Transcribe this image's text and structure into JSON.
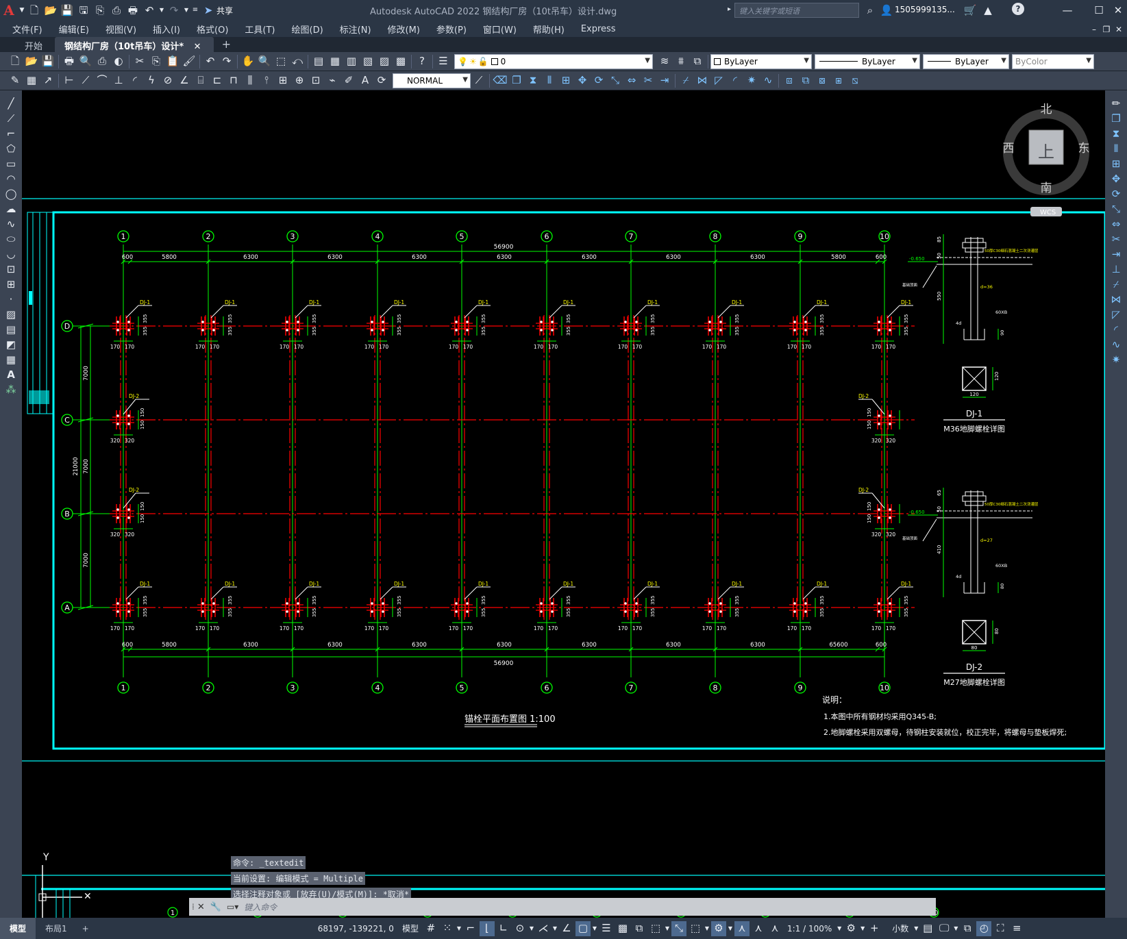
{
  "app": {
    "logo": "A",
    "title": "Autodesk AutoCAD 2022    钢结构厂房（10t吊车）设计.dwg",
    "share_label": "共享",
    "search_placeholder": "键入关键字或短语",
    "user": "1505999135...",
    "window_controls": [
      "—",
      "☐",
      "✕"
    ]
  },
  "menu": [
    "文件(F)",
    "编辑(E)",
    "视图(V)",
    "插入(I)",
    "格式(O)",
    "工具(T)",
    "绘图(D)",
    "标注(N)",
    "修改(M)",
    "参数(P)",
    "窗口(W)",
    "帮助(H)",
    "Express"
  ],
  "tabs": {
    "start": "开始",
    "doc": "钢结构厂房（10t吊车）设计*",
    "close": "✕",
    "add": "+"
  },
  "toolbar": {
    "layer": "0",
    "color": "ByLayer",
    "linetype": "ByLayer",
    "lineweight": "ByLayer",
    "plotstyle": "ByColor",
    "dimstyle": "NORMAL"
  },
  "viewcube": {
    "north": "北",
    "south": "南",
    "east": "东",
    "west": "西",
    "top": "上",
    "wcs": "WCS"
  },
  "drawing": {
    "axes_x": [
      "1",
      "2",
      "3",
      "4",
      "5",
      "6",
      "7",
      "8",
      "9",
      "10"
    ],
    "axes_y": [
      "D",
      "C",
      "B",
      "A"
    ],
    "total_width": "56900",
    "spans": [
      "600",
      "5800",
      "6300",
      "6300",
      "6300",
      "6300",
      "6300",
      "6300",
      "6300",
      "5800",
      "600"
    ],
    "spans_bottom": [
      "600",
      "5800",
      "6300",
      "6300",
      "6300",
      "6300",
      "6300",
      "6300",
      "6300",
      "65600",
      "600"
    ],
    "vert_dims": [
      "7000",
      "7000",
      "7000"
    ],
    "vert_total": "21000",
    "dj1": "DJ-1",
    "dj2": "DJ-2",
    "dim355": "355",
    "dim170": "170",
    "dim320": "320",
    "dim150": "150",
    "plan_title": "锚栓平面布置图 1:100",
    "notes_title": "说明：",
    "note1": "1.本图中所有钢材均采用Q345-B;",
    "note2": "2.地脚螺栓采用双螺母，待钢柱安装就位，校正完毕，将螺母与垫板焊死;",
    "detail1_name": "DJ-1",
    "detail1_title": "M36地脚螺栓详图",
    "detail2_name": "DJ-2",
    "detail2_title": "M27地脚螺栓详图",
    "d1": {
      "elev": "-0.650",
      "fill": "50厚C30细石混凝土二次浇灌层",
      "base": "基础顶面",
      "d": "d=36",
      "len": "550",
      "top": "85",
      "t2": "50",
      "hook": "60XB",
      "h4": "4d",
      "b": "90",
      "plate": "120",
      "plate2": "120"
    },
    "d2": {
      "elev": "-0.650",
      "fill": "50厚C30细石混凝土二次浇灌层",
      "base": "基础顶面",
      "d": "d=27",
      "len": "410",
      "top": "65",
      "t2": "50",
      "hook": "60XB",
      "h4": "4d",
      "b": "80",
      "plate": "80",
      "plate2": "80"
    }
  },
  "command": {
    "line1": "命令: _textedit",
    "line2": "当前设置: 编辑模式 = Multiple",
    "line3": "选择注释对象或 [放弃(U)/模式(M)]: *取消*",
    "placeholder": "键入命令"
  },
  "ucs": {
    "y": "Y"
  },
  "status": {
    "model_tab": "模型",
    "layout_tab": "布局1",
    "add": "+",
    "coords": "68197, -139221, 0",
    "model": "模型",
    "scale": "1:1 / 100%",
    "units": "小数"
  },
  "colors": {
    "axis_green": "#00ff00",
    "column_red": "#ff0000",
    "frame_cyan": "#00ffff",
    "text_white": "#ffffff",
    "text_yellow": "#ffff00"
  }
}
